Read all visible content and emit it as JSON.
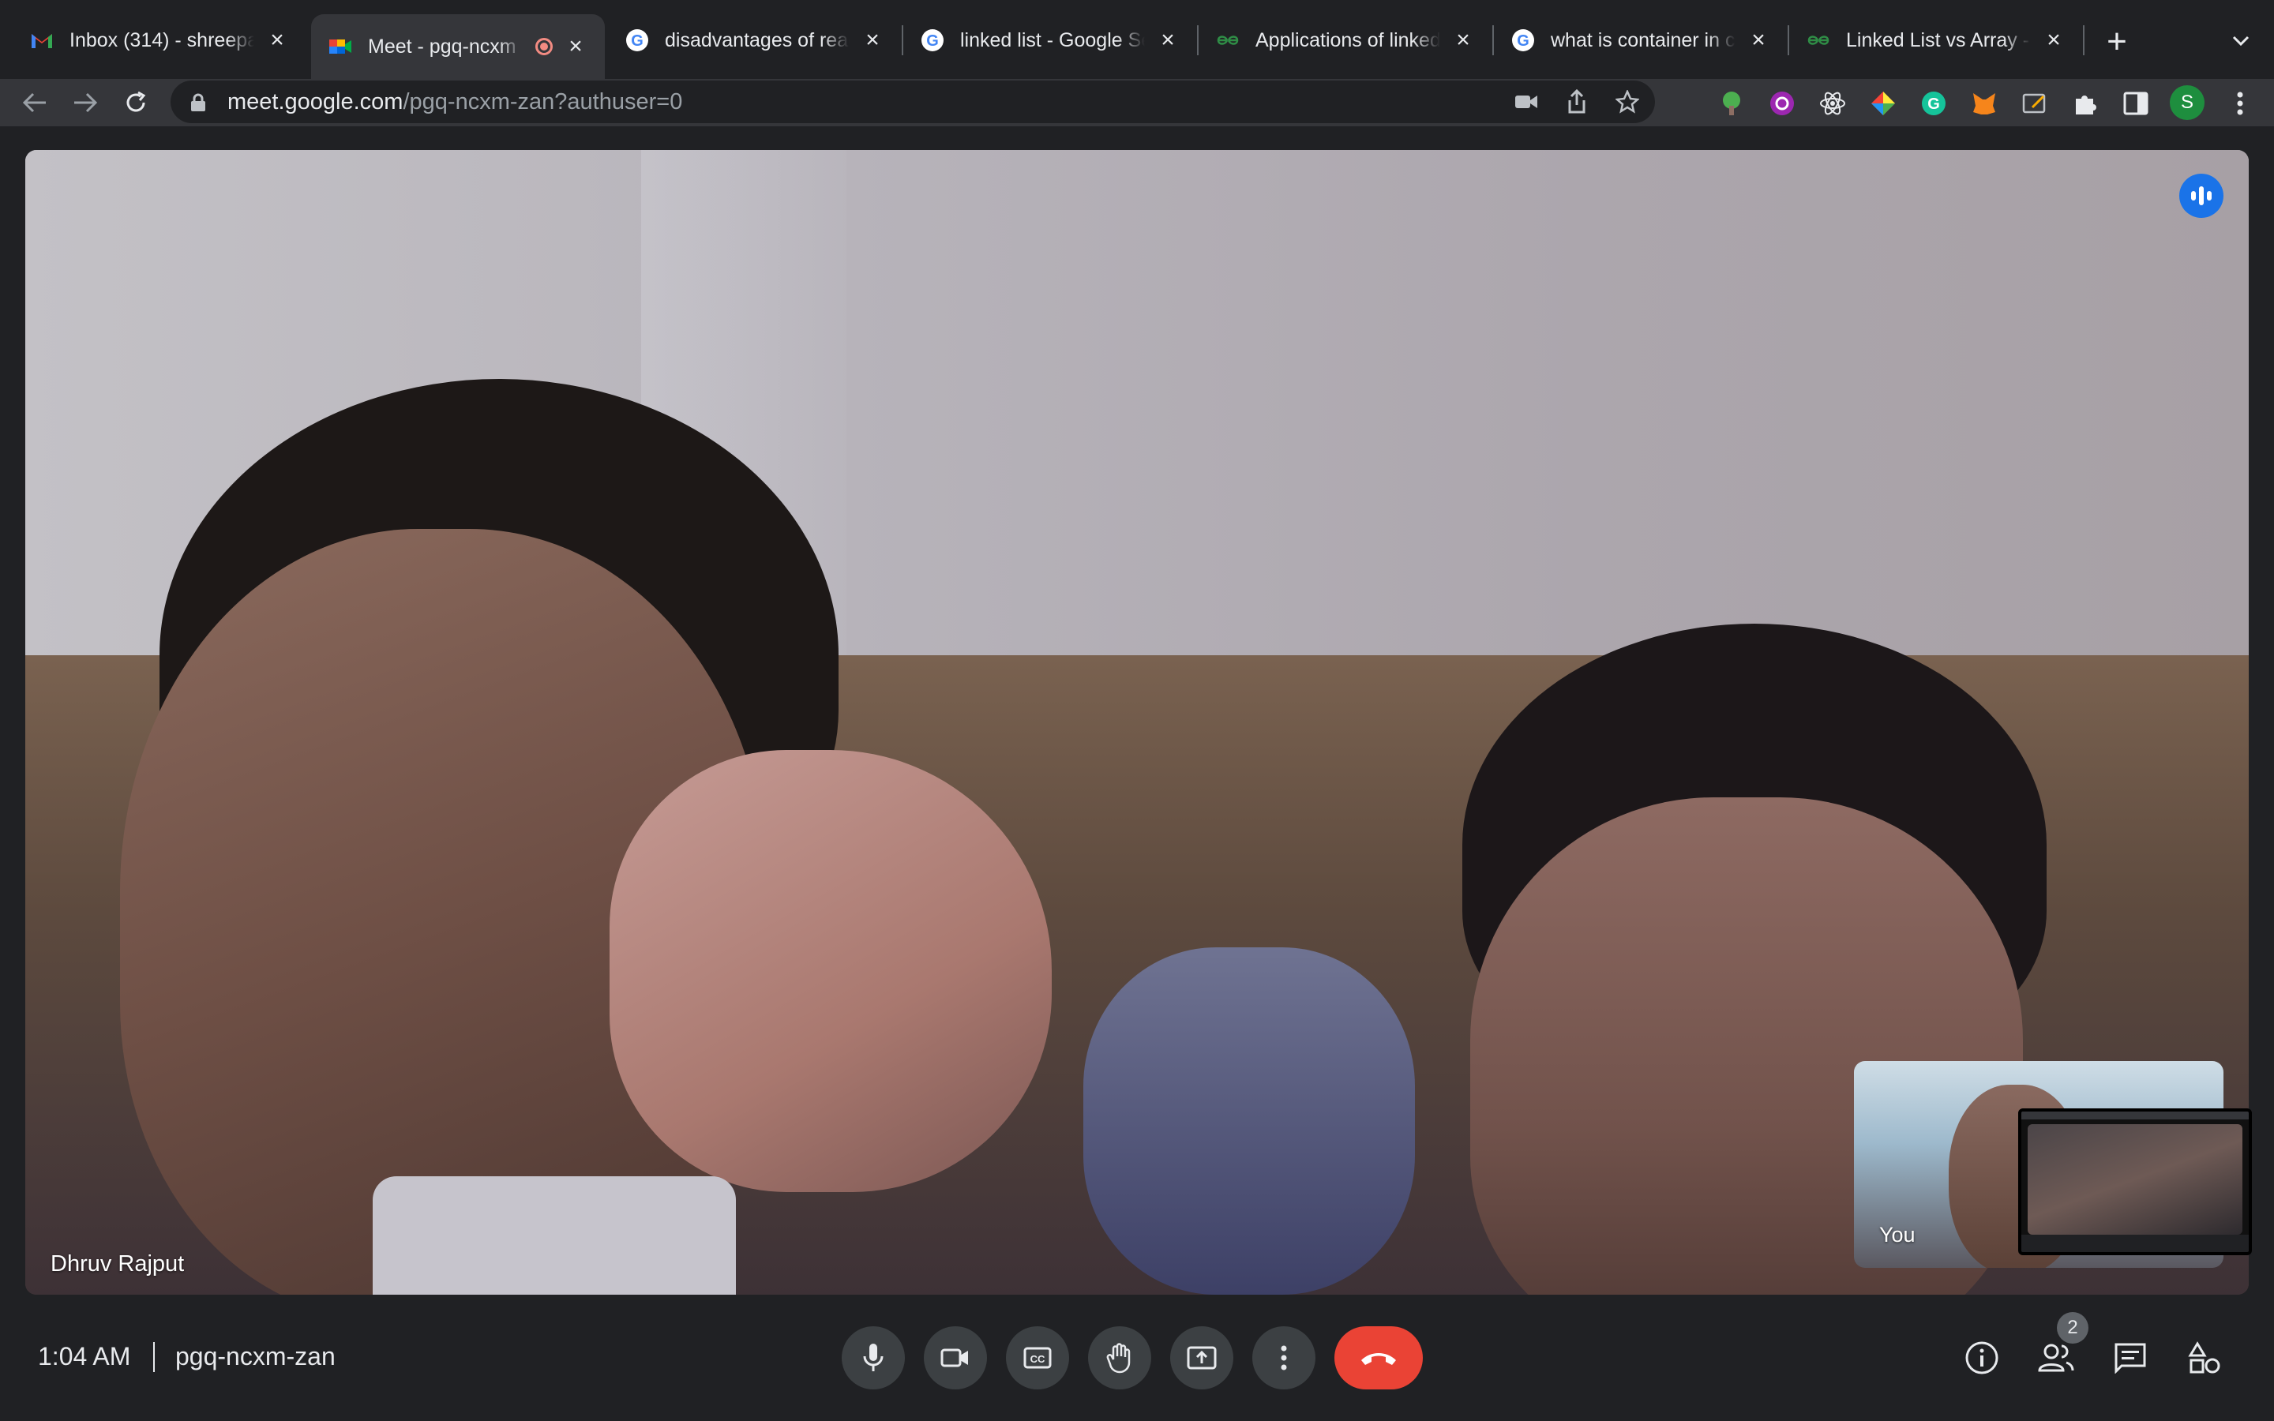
{
  "browser": {
    "tabs": [
      {
        "title": "Inbox (314) - shreepa",
        "favicon": "gmail-icon"
      },
      {
        "title": "Meet - pgq-ncxm",
        "favicon": "google-meet-icon",
        "recording": true
      },
      {
        "title": "disadvantages of read",
        "favicon": "google-icon"
      },
      {
        "title": "linked list - Google Se",
        "favicon": "google-icon"
      },
      {
        "title": "Applications of linked",
        "favicon": "geeksforgeeks-icon"
      },
      {
        "title": "what is container in cl",
        "favicon": "google-icon"
      },
      {
        "title": "Linked List vs Array -",
        "favicon": "geeksforgeeks-icon"
      }
    ],
    "url": {
      "host": "meet.google.com",
      "path": "/pgq-ncxm-zan?authuser=0"
    },
    "profile_initial": "S"
  },
  "meet": {
    "participant_name": "Dhruv Rajput",
    "self_label": "You",
    "time": "1:04 AM",
    "meeting_code": "pgq-ncxm-zan",
    "participants_count": "2"
  },
  "colors": {
    "end_call": "#ea4335",
    "speaking_indicator": "#1a73e8",
    "background": "#202124"
  }
}
